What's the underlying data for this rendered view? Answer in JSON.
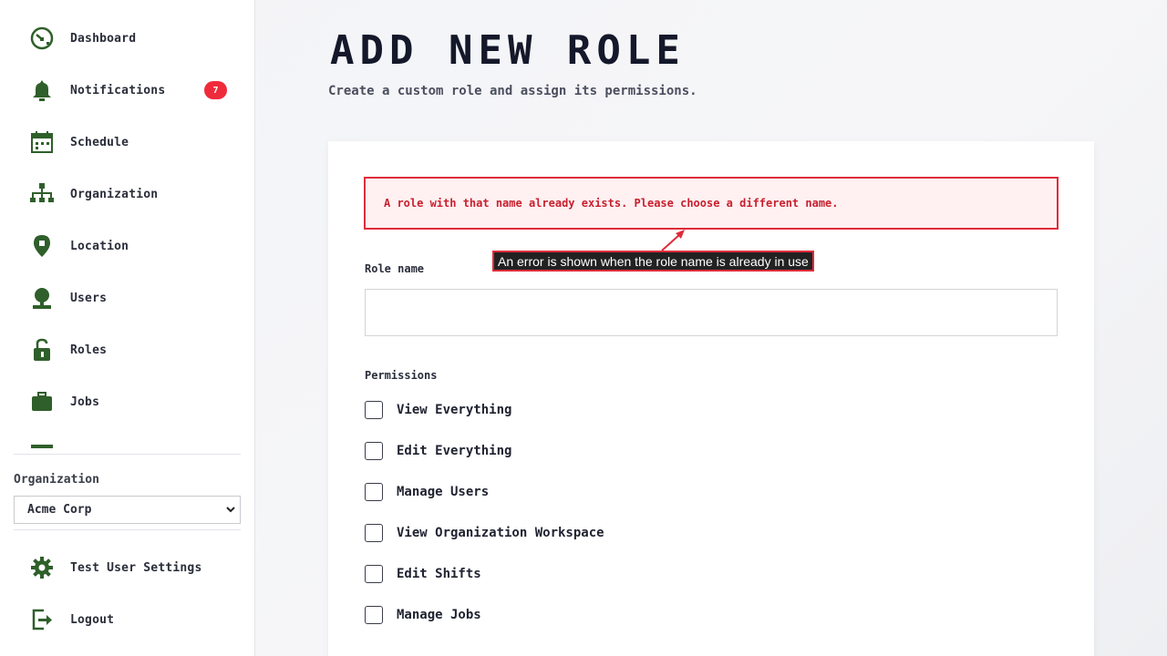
{
  "sidebar": {
    "nav_items": [
      {
        "label": "Dashboard",
        "icon": "dashboard-icon"
      },
      {
        "label": "Notifications",
        "icon": "bell-icon",
        "badge": "7"
      },
      {
        "label": "Schedule",
        "icon": "calendar-icon"
      },
      {
        "label": "Organization",
        "icon": "org-chart-icon"
      },
      {
        "label": "Location",
        "icon": "location-pin-icon"
      },
      {
        "label": "Users",
        "icon": "user-icon"
      },
      {
        "label": "Roles",
        "icon": "lock-icon"
      },
      {
        "label": "Jobs",
        "icon": "briefcase-icon"
      }
    ],
    "organization_label": "Organization",
    "organization_selected": "Acme Corp",
    "settings_label": "Test User Settings",
    "logout_label": "Logout"
  },
  "page": {
    "title": "ADD NEW ROLE",
    "subtitle": "Create a custom role and assign its permissions."
  },
  "form": {
    "error_message": "A role with that name already exists. Please choose a different name.",
    "role_name_label": "Role name",
    "role_name_value": "",
    "permissions_label": "Permissions",
    "permissions": [
      {
        "label": "View Everything",
        "checked": false
      },
      {
        "label": "Edit Everything",
        "checked": false
      },
      {
        "label": "Manage Users",
        "checked": false
      },
      {
        "label": "View Organization Workspace",
        "checked": false
      },
      {
        "label": "Edit Shifts",
        "checked": false
      },
      {
        "label": "Manage Jobs",
        "checked": false
      }
    ]
  },
  "annotation": {
    "text": "An error is shown when the role name is already in use"
  },
  "colors": {
    "icon_green": "#2f5f2a",
    "error_red": "#e02b3b",
    "badge_red": "#ef2b3b"
  }
}
